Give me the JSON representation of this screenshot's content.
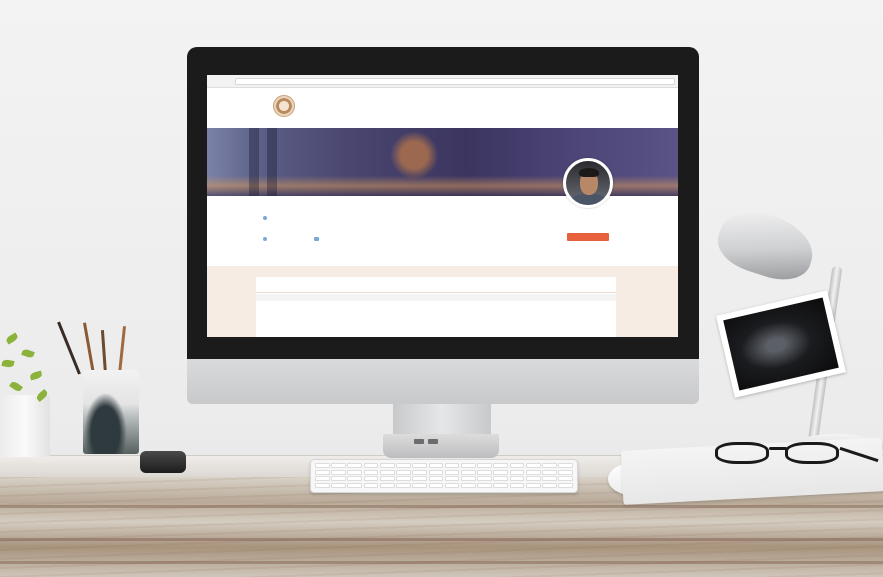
{
  "website": {
    "header_top_text": "",
    "nav_items": [
      "",
      "",
      "",
      "",
      "",
      "",
      "",
      ""
    ],
    "profile": {
      "name": "",
      "address_line_1": "",
      "address_line_2": "",
      "address_line_3": "",
      "phone": "",
      "email": "",
      "stat_1_label": "",
      "stat_1_value": "",
      "stat_2_label": "",
      "stat_3_label": "",
      "stat_3_value": "",
      "cta_label": ""
    },
    "section": {
      "title": "",
      "column_1": "",
      "column_2": "",
      "row_1_col_1": "",
      "row_1_col_2": ""
    }
  },
  "colors": {
    "accent": "#e8603c",
    "link": "#7aa9d8",
    "section_bg": "#f7ece4",
    "banner_dark": "#3b3560"
  }
}
